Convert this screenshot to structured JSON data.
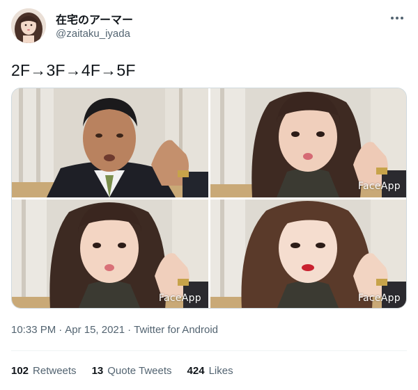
{
  "author": {
    "display_name": "在宅のアーマー",
    "handle": "@zaitaku_iyada"
  },
  "tweet": {
    "text": "2F→3F→4F→5F"
  },
  "media": {
    "watermarks": [
      "FaceApp",
      "FaceApp",
      "FaceApp"
    ]
  },
  "meta": {
    "time": "10:33 PM",
    "separator": "·",
    "date": "Apr 15, 2021",
    "source": "Twitter for Android"
  },
  "stats": {
    "retweets": {
      "count": "102",
      "label": "Retweets"
    },
    "quotes": {
      "count": "13",
      "label": "Quote Tweets"
    },
    "likes": {
      "count": "424",
      "label": "Likes"
    }
  },
  "colors": {
    "text_primary": "#0f1419",
    "text_secondary": "#536471",
    "divider": "#eff3f4",
    "border": "#cfd9de"
  },
  "icons": {
    "more": "more-horizontal-icon"
  }
}
